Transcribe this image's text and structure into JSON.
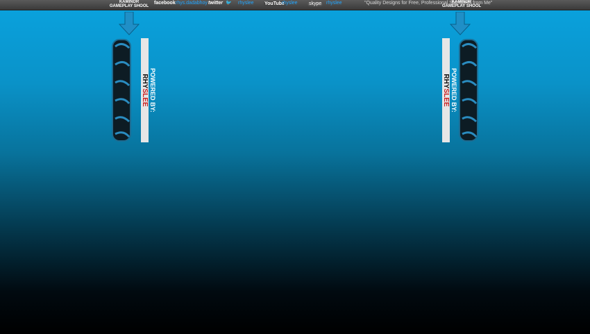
{
  "topbar": {
    "brand_top": "KAMINDR",
    "brand_bottom": "GAMEPLAY SHOOL",
    "facebook_label": "facebook",
    "facebook_handle": "rhys.dadabhoy",
    "twitter_label": "twitter",
    "twitter_handle": "rhyslee",
    "youtube_label": "YouTube",
    "youtube_handle": "rhyslee",
    "skype_label": "skype",
    "skype_handle": "rhyslee",
    "quote": "\"Quality Designs for Free, Professional Standards from Me\""
  },
  "banner": {
    "powered_by": "POWERED BY:",
    "name_part1": "RHY",
    "name_part2": "SLEE"
  },
  "colors": {
    "bg_top": "#0aa3df",
    "bg_bottom": "#000000",
    "link_blue": "#22a6ff",
    "accent_red": "#c81f1f"
  }
}
